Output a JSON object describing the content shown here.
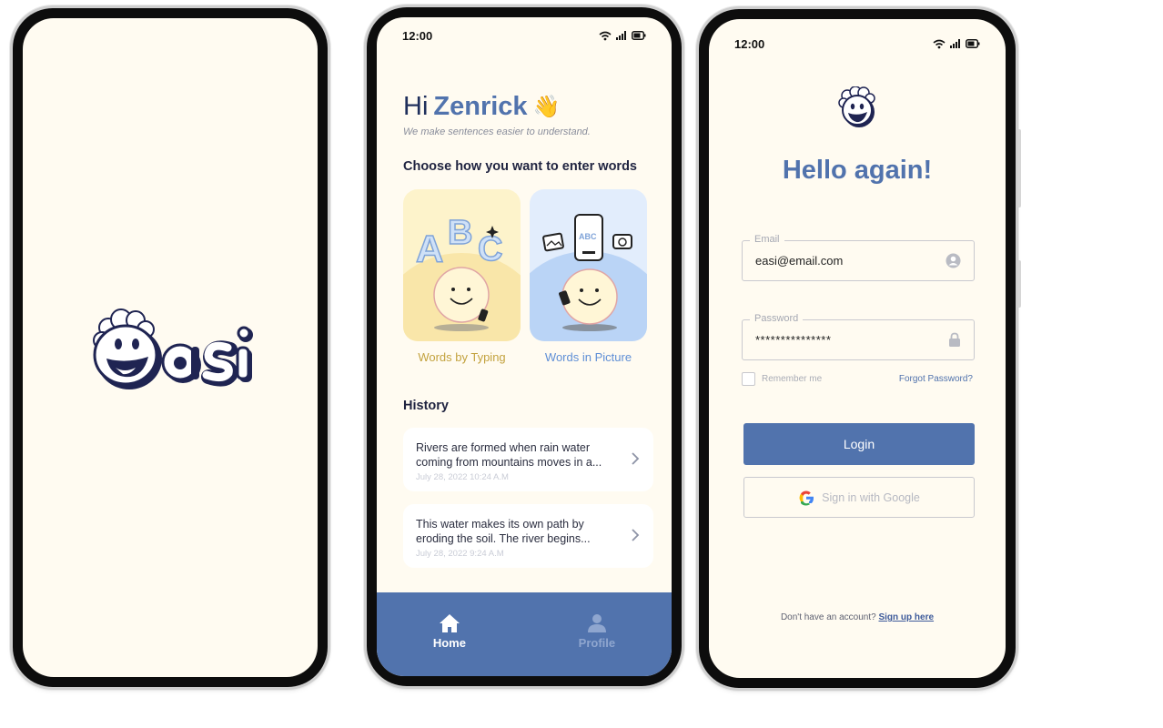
{
  "colors": {
    "accent": "#5173ad",
    "background": "#fffbf1",
    "dark": "#1f2f5c",
    "typing_card": "#fbefc2",
    "picture_card": "#d8e7fb"
  },
  "status": {
    "time": "12:00"
  },
  "splash": {
    "logo_text": "easi"
  },
  "home": {
    "greeting": "Hi",
    "name": "Zenrick",
    "wave_emoji": "👋",
    "subtitle": "We make sentences easier to understand.",
    "choose_heading": "Choose how you want to enter words",
    "options": [
      {
        "label": "Words by Typing",
        "icon": "abc-typing-illustration",
        "color": "#c3a23e"
      },
      {
        "label": "Words in Picture",
        "icon": "phone-camera-illustration",
        "color": "#5f8fd6"
      }
    ],
    "history_heading": "History",
    "history": [
      {
        "text": "Rivers are formed when rain water coming from mountains moves in a...",
        "date": "July 28, 2022 10:24 A.M"
      },
      {
        "text": "This water makes its own path by eroding the soil. The river begins...",
        "date": "July 28, 2022 9:24 A.M"
      }
    ],
    "nav": [
      {
        "label": "Home",
        "icon": "home-icon",
        "active": true
      },
      {
        "label": "Profile",
        "icon": "profile-icon",
        "active": false
      }
    ]
  },
  "login": {
    "title": "Hello again!",
    "email_label": "Email",
    "email_value": "easi@email.com",
    "password_label": "Password",
    "password_value": "***************",
    "remember_label": "Remember me",
    "forgot_label": "Forgot Password?",
    "login_button": "Login",
    "google_button": "Sign in with Google",
    "signup_prompt": "Don't have an account?",
    "signup_link": "Sign up here"
  }
}
